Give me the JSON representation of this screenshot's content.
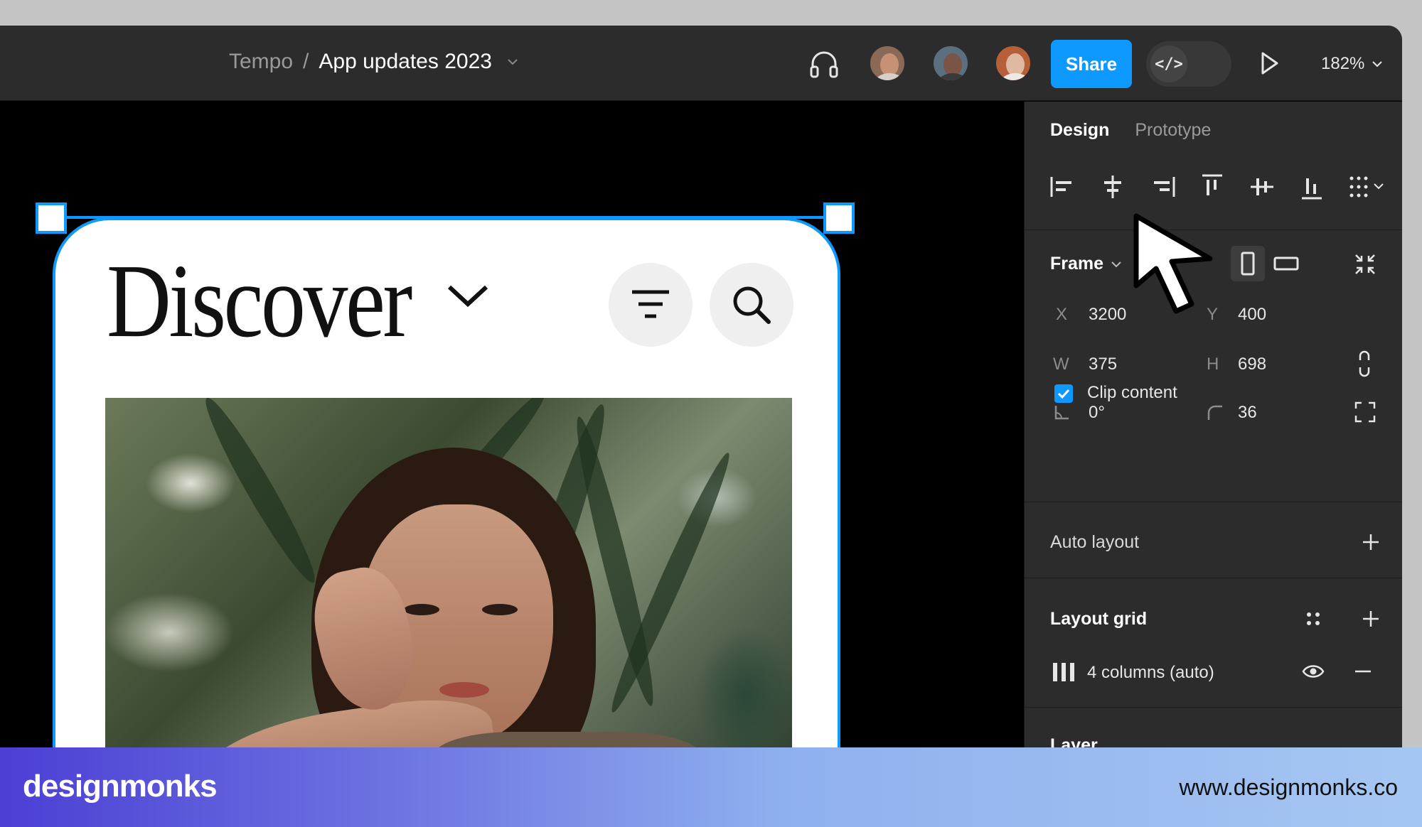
{
  "toolbar": {
    "breadcrumb_team": "Tempo",
    "breadcrumb_separator": "/",
    "breadcrumb_file": "App updates 2023",
    "share_label": "Share",
    "dev_mode_label": "</>",
    "zoom": "182%"
  },
  "avatars": [
    {
      "name": "collaborator-1",
      "skin": "#c69273",
      "shirt": "#d8d0c8"
    },
    {
      "name": "collaborator-2",
      "skin": "#7a5444",
      "shirt": "#3a3a3a"
    },
    {
      "name": "collaborator-3",
      "skin": "#e0b9a2",
      "shirt": "#f0e8e4"
    }
  ],
  "canvas": {
    "frame_title": "Discover"
  },
  "panel": {
    "tab_design": "Design",
    "tab_prototype": "Prototype",
    "frame_label": "Frame",
    "x_label": "X",
    "x_value": "3200",
    "y_label": "Y",
    "y_value": "400",
    "w_label": "W",
    "w_value": "375",
    "h_label": "H",
    "h_value": "698",
    "rotation_value": "0°",
    "radius_value": "36",
    "clip_content_label": "Clip content",
    "clip_content_checked": true,
    "auto_layout_label": "Auto layout",
    "layout_grid_label": "Layout grid",
    "grid_item_label": "4 columns (auto)",
    "layer_label": "Layer"
  },
  "colors": {
    "accent": "#0d99ff",
    "toolbar_bg": "#2c2c2c",
    "canvas_bg": "#000000"
  },
  "banner": {
    "brand": "designmonks",
    "site": "www.designmonks.co"
  }
}
